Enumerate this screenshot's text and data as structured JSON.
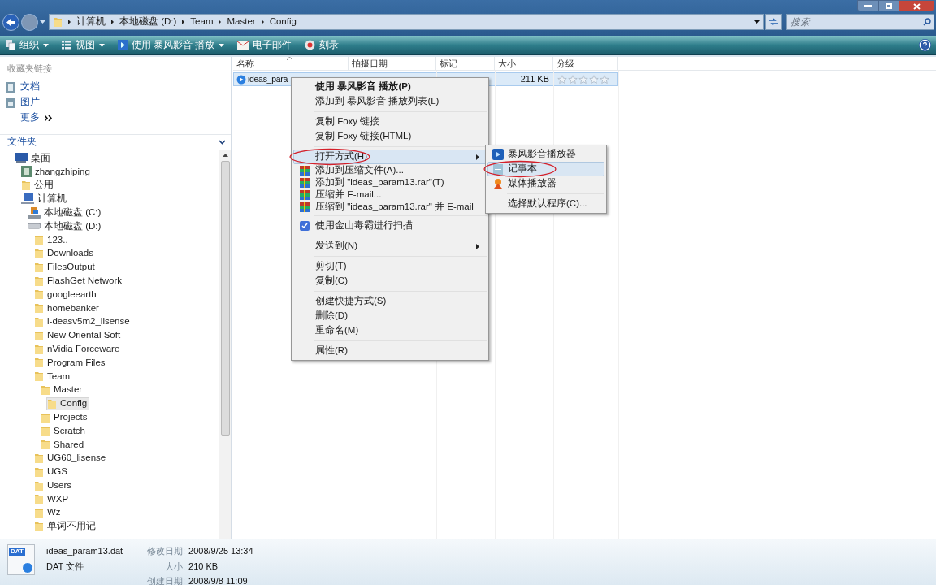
{
  "window_controls": [
    {
      "kind": "minimize"
    },
    {
      "kind": "maximize"
    },
    {
      "kind": "close"
    }
  ],
  "breadcrumb": [
    "计算机",
    "本地磁盘 (D:)",
    "Team",
    "Master",
    "Config"
  ],
  "search": {
    "placeholder": "搜索"
  },
  "toolbar": [
    {
      "label": "组织",
      "kind": "organize",
      "dropdown": true
    },
    {
      "label": "视图",
      "kind": "views",
      "dropdown": true
    },
    {
      "label": "使用 暴风影音 播放",
      "kind": "play",
      "dropdown": true
    },
    {
      "label": "电子邮件",
      "kind": "email",
      "dropdown": false
    },
    {
      "label": "刻录",
      "kind": "burn",
      "dropdown": false
    }
  ],
  "favorites": {
    "title": "收藏夹链接",
    "links": [
      {
        "label": "文档",
        "kind": "doc"
      },
      {
        "label": "图片",
        "kind": "pic"
      },
      {
        "label": "更多",
        "kind": "more"
      }
    ]
  },
  "folders": {
    "title": "文件夹",
    "tree": [
      {
        "label": "桌面",
        "kind": "desktop",
        "selected": false,
        "children": [
          {
            "label": "zhangzhiping",
            "kind": "user",
            "selected": false
          },
          {
            "label": "公用",
            "kind": "folder",
            "selected": false
          },
          {
            "label": "计算机",
            "kind": "computer",
            "selected": false,
            "children": [
              {
                "label": "本地磁盘 (C:)",
                "kind": "system-drive",
                "selected": false
              },
              {
                "label": "本地磁盘 (D:)",
                "kind": "drive",
                "selected": false,
                "children": [
                  {
                    "label": "123..",
                    "kind": "folder",
                    "selected": false
                  },
                  {
                    "label": "Downloads",
                    "kind": "folder",
                    "selected": false
                  },
                  {
                    "label": "FilesOutput",
                    "kind": "folder",
                    "selected": false
                  },
                  {
                    "label": "FlashGet Network",
                    "kind": "folder",
                    "selected": false
                  },
                  {
                    "label": "googleearth",
                    "kind": "folder",
                    "selected": false
                  },
                  {
                    "label": "homebanker",
                    "kind": "folder",
                    "selected": false
                  },
                  {
                    "label": "i-deasv5m2_lisense",
                    "kind": "folder",
                    "selected": false
                  },
                  {
                    "label": "New Oriental Soft",
                    "kind": "folder",
                    "selected": false
                  },
                  {
                    "label": "nVidia Forceware",
                    "kind": "folder",
                    "selected": false
                  },
                  {
                    "label": "Program Files",
                    "kind": "folder",
                    "selected": false
                  },
                  {
                    "label": "Team",
                    "kind": "folder",
                    "selected": false,
                    "children": [
                      {
                        "label": "Master",
                        "kind": "folder",
                        "selected": false,
                        "children": [
                          {
                            "label": "Config",
                            "kind": "folder",
                            "selected": true
                          }
                        ]
                      },
                      {
                        "label": "Projects",
                        "kind": "folder",
                        "selected": false
                      },
                      {
                        "label": "Scratch",
                        "kind": "folder",
                        "selected": false
                      },
                      {
                        "label": "Shared",
                        "kind": "folder",
                        "selected": false
                      }
                    ]
                  },
                  {
                    "label": "UG60_lisense",
                    "kind": "folder",
                    "selected": false
                  },
                  {
                    "label": "UGS",
                    "kind": "folder",
                    "selected": false
                  },
                  {
                    "label": "Users",
                    "kind": "folder",
                    "selected": false
                  },
                  {
                    "label": "WXP",
                    "kind": "folder",
                    "selected": false
                  },
                  {
                    "label": "Wz",
                    "kind": "folder",
                    "selected": false
                  },
                  {
                    "label": "单词不用记",
                    "kind": "folder",
                    "selected": false
                  }
                ]
              }
            ]
          }
        ]
      }
    ]
  },
  "columns": [
    "名称",
    "拍摄日期",
    "标记",
    "大小",
    "分级"
  ],
  "files": [
    {
      "name": "ideas_para",
      "size": "211 KB",
      "stars": 0,
      "selected": true
    }
  ],
  "context_menu": [
    {
      "kind": "item",
      "label": "使用 暴风影音 播放(P)",
      "bold": true,
      "selected": false
    },
    {
      "kind": "item",
      "label": "添加到 暴风影音 播放列表(L)",
      "selected": false
    },
    {
      "kind": "separator"
    },
    {
      "kind": "item",
      "label": "复制 Foxy 链接",
      "selected": false
    },
    {
      "kind": "item",
      "label": "复制 Foxy 链接(HTML)",
      "selected": false
    },
    {
      "kind": "separator"
    },
    {
      "kind": "item",
      "label": "打开方式(H)",
      "selected": true,
      "submenu": true,
      "circled": true
    },
    {
      "kind": "archive",
      "label": "添加到压缩文件(A)...",
      "selected": false
    },
    {
      "kind": "archive",
      "label": "添加到 \"ideas_param13.rar\"(T)",
      "selected": false
    },
    {
      "kind": "archive",
      "label": "压缩并 E-mail...",
      "selected": false
    },
    {
      "kind": "archive",
      "label": "压缩到 \"ideas_param13.rar\" 并 E-mail",
      "selected": false
    },
    {
      "kind": "separator"
    },
    {
      "kind": "scan",
      "label": "使用金山毒霸进行扫描",
      "selected": false
    },
    {
      "kind": "separator"
    },
    {
      "kind": "item",
      "label": "发送到(N)",
      "selected": false,
      "submenu": true
    },
    {
      "kind": "separator"
    },
    {
      "kind": "item",
      "label": "剪切(T)",
      "selected": false
    },
    {
      "kind": "item",
      "label": "复制(C)",
      "selected": false
    },
    {
      "kind": "separator"
    },
    {
      "kind": "item",
      "label": "创建快捷方式(S)",
      "selected": false
    },
    {
      "kind": "item",
      "label": "删除(D)",
      "selected": false
    },
    {
      "kind": "item",
      "label": "重命名(M)",
      "selected": false
    },
    {
      "kind": "separator"
    },
    {
      "kind": "item",
      "label": "属性(R)",
      "selected": false
    }
  ],
  "open_with_menu": [
    {
      "kind": "player",
      "label": "暴风影音播放器",
      "selected": false
    },
    {
      "kind": "notepad",
      "label": "记事本",
      "selected": true,
      "circled": true
    },
    {
      "kind": "media",
      "label": "媒体播放器",
      "selected": false
    },
    {
      "kind": "separator"
    },
    {
      "kind": "item",
      "label": "选择默认程序(C)...",
      "selected": false
    }
  ],
  "details": {
    "icon_label": "DAT",
    "name": "ideas_param13.dat",
    "type": "DAT 文件",
    "fields": [
      {
        "label": "修改日期:",
        "value": "2008/9/25 13:34"
      },
      {
        "label": "大小:",
        "value": "210 KB"
      },
      {
        "label": "创建日期:",
        "value": "2008/9/8 11:09"
      }
    ]
  }
}
